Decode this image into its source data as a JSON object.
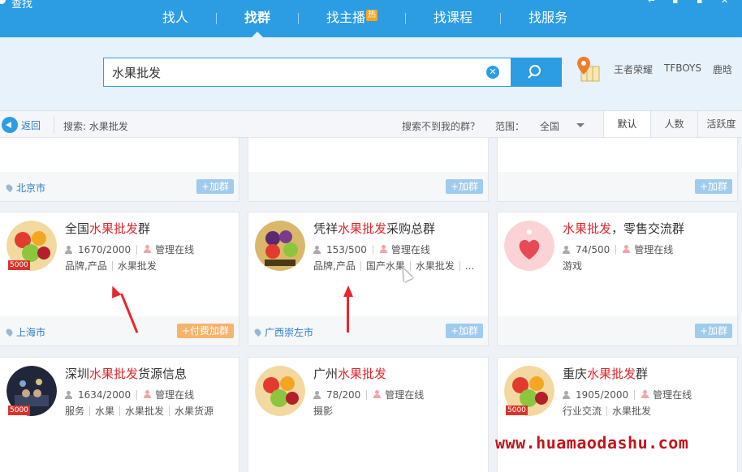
{
  "window": {
    "title": "查找"
  },
  "nav": {
    "items": [
      {
        "label": "找人"
      },
      {
        "label": "找群"
      },
      {
        "label": "找主播",
        "badge": "热"
      },
      {
        "label": "找课程"
      },
      {
        "label": "找服务"
      }
    ]
  },
  "search": {
    "value": "水果批发",
    "hot_tags": [
      "王者荣耀",
      "TFBOYS",
      "鹿晗"
    ]
  },
  "filter": {
    "back_label": "返回",
    "query_label": "搜索: 水果批发",
    "not_found": "搜索不到我的群？",
    "range_label": "范围：",
    "range_value": "全国",
    "sort_tabs": [
      "默认",
      "人数",
      "活跃度"
    ]
  },
  "top_partial_cards": [
    {
      "city": "北京市",
      "join": "+加群"
    },
    {
      "city": "",
      "join": "+加群"
    },
    {
      "city": "",
      "join": "+加群"
    }
  ],
  "groups_row1": [
    {
      "name_pre": "全国",
      "name_hl": "水果批发",
      "name_post": "群",
      "members": "1670/2000",
      "admin": "管理在线",
      "tags": [
        "品牌,产品",
        "水果批发"
      ],
      "city": "上海市",
      "join": "+付费加群",
      "badge": "5000"
    },
    {
      "name_pre": "凭祥",
      "name_hl": "水果批发",
      "name_post": "采购总群",
      "members": "153/500",
      "admin": "管理在线",
      "tags": [
        "品牌,产品",
        "国产水果",
        "水果批发",
        "..."
      ],
      "city": "广西崇左市",
      "join": "+加群",
      "badge": ""
    },
    {
      "name_pre": "",
      "name_hl": "水果批发",
      "name_post": "，零售交流群",
      "members": "74/500",
      "admin": "管理在线",
      "tags": [
        "游戏"
      ],
      "city": "",
      "join": "+加群",
      "badge": ""
    }
  ],
  "groups_row2": [
    {
      "name_pre": "深圳",
      "name_hl": "水果批发",
      "name_post": "货源信息",
      "members": "1634/2000",
      "admin": "管理在线",
      "tags": [
        "服务",
        "水果",
        "水果批发",
        "水果货源"
      ],
      "badge": "5000"
    },
    {
      "name_pre": "广州",
      "name_hl": "水果批发",
      "name_post": "",
      "members": "78/200",
      "admin": "管理在线",
      "tags": [
        "摄影"
      ],
      "badge": ""
    },
    {
      "name_pre": "重庆",
      "name_hl": "水果批发",
      "name_post": "群",
      "members": "1905/2000",
      "admin": "管理在线",
      "tags": [
        "行业交流",
        "水果批发"
      ],
      "badge": "5000"
    }
  ],
  "watermark": "www.huamaodashu.com",
  "colors": {
    "primary": "#2c9de3",
    "highlight": "#e1252b",
    "paid": "#f6b36b"
  }
}
